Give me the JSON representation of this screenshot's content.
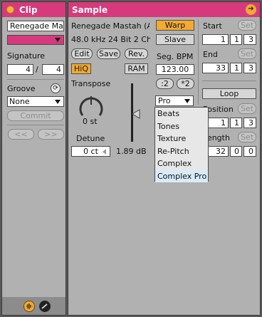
{
  "colors": {
    "titlebar": "#d63a7c",
    "accent": "#f3aa30",
    "panel": "#b1b1b1",
    "menu_highlight": "#d7ecf9"
  },
  "clip_panel": {
    "title": "Clip",
    "clip_name": "Renegade Mas",
    "signature_label": "Signature",
    "signature_numerator": "4",
    "signature_slash": "/",
    "signature_denominator": "4",
    "groove_label": "Groove",
    "groove_value": "None",
    "commit_label": "Commit",
    "prev_label": "<<",
    "next_label": ">>"
  },
  "sample_panel": {
    "title": "Sample",
    "sample_name": "Renegade Mastah (A",
    "sample_info": "48.0 kHz 24 Bit 2 Ch",
    "edit_label": "Edit",
    "save_label": "Save",
    "rev_label": "Rev.",
    "hiq_label": "HiQ",
    "ram_label": "RAM",
    "transpose_label": "Transpose",
    "transpose_value": "0 st",
    "detune_label": "Detune",
    "detune_value": "0 ct",
    "gain_value": "1.89 dB",
    "warp_label": "Warp",
    "slave_label": "Slave",
    "seg_bpm_label": "Seg. BPM",
    "seg_bpm_value": "123.00",
    "halve_label": ":2",
    "double_label": "*2",
    "warp_mode_value": "Pro",
    "start_label": "Start",
    "set_label": "Set",
    "start_bar": "1",
    "start_beat": "1",
    "start_sixteenth": "3",
    "end_label": "End",
    "end_bar": "33",
    "end_beat": "1",
    "end_sixteenth": "3",
    "loop_label": "Loop",
    "position_label": "Position",
    "position_bar": "1",
    "position_beat": "1",
    "position_sixteenth": "3",
    "length_label": "Length",
    "length_bar": "32",
    "length_beat": "0",
    "length_sixteenth": "0"
  },
  "warp_mode_menu": {
    "items": [
      "Beats",
      "Tones",
      "Texture",
      "Re-Pitch",
      "Complex",
      "Complex Pro"
    ],
    "selected": "Complex Pro"
  },
  "icons": {
    "clip_toggle": "orange-dot-icon",
    "sample_expand": "arrow-right-circle-icon",
    "groove_hot_swap": "hot-swap-icon",
    "bottom_left": "waveform-icon",
    "bottom_right": "envelope-icon"
  }
}
